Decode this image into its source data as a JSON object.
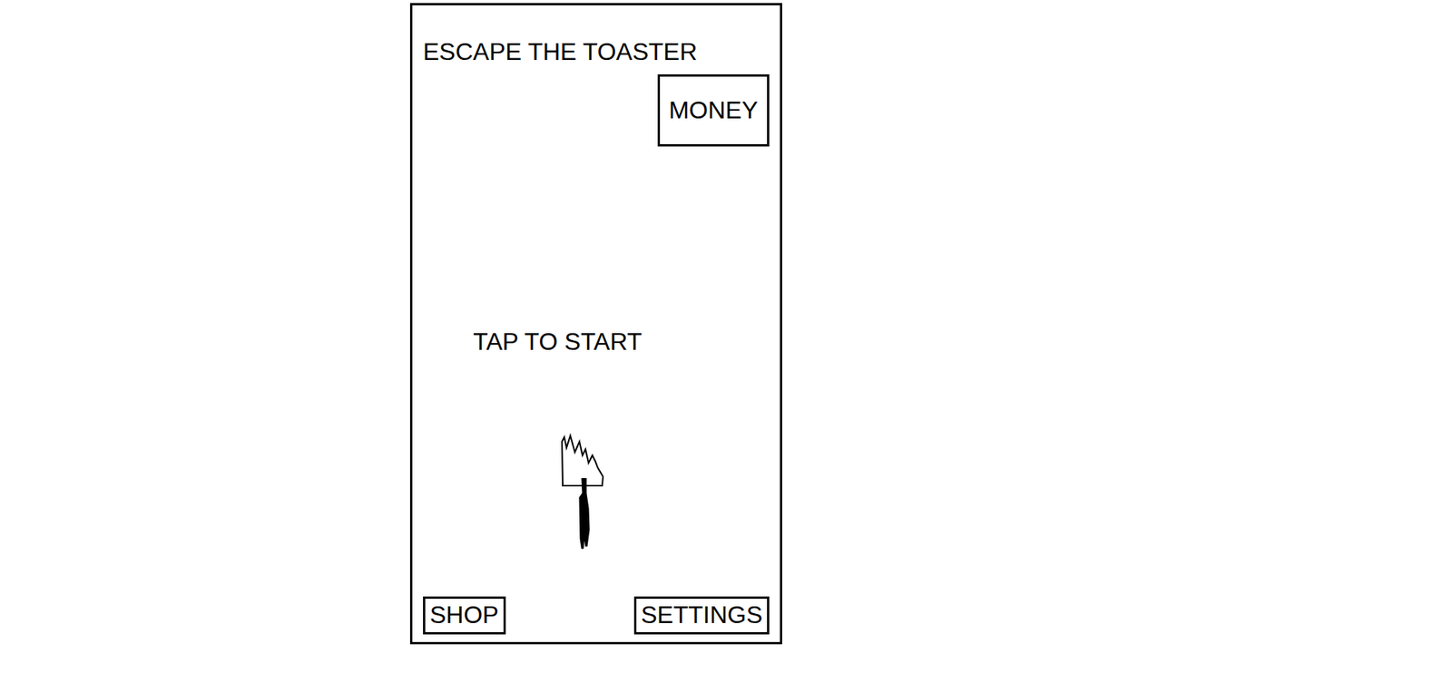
{
  "title": "ESCAPE THE TOASTER",
  "money": {
    "label": "MONEY"
  },
  "prompt": "TAP TO START",
  "buttons": [
    {
      "label": "SHOP"
    },
    {
      "label": "SETTINGS"
    }
  ]
}
